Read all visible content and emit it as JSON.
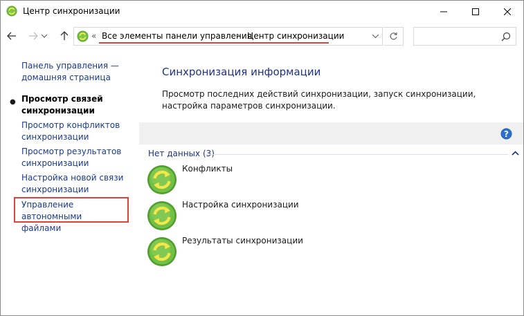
{
  "window": {
    "title": "Центр синхронизации",
    "icon": "sync-center-icon",
    "controls": [
      "minimize-icon",
      "maximize-icon",
      "close-icon"
    ]
  },
  "navigation": {
    "back_icon": "arrow-left-icon",
    "forward_icon": "arrow-right-icon",
    "recent_icon": "chevron-down-icon",
    "up_icon": "arrow-up-icon",
    "address": {
      "overflow_chevron": "«",
      "crumbs": [
        "Все элементы панели управления",
        "Центр синхронизации"
      ],
      "separator": "›",
      "highlight_color": "#e0413a"
    },
    "refresh_icon": "refresh-icon",
    "search": {
      "placeholder": "",
      "value": "",
      "icon": "search-icon"
    }
  },
  "sidebar": {
    "items": [
      {
        "label": "Панель управления —\nдомашняя страница",
        "current": false
      },
      {
        "label": "Просмотр связей\nсинхронизации",
        "current": true
      },
      {
        "label": "Просмотр конфликтов\nсинхронизации",
        "current": false
      },
      {
        "label": "Просмотр результатов\nсинхронизации",
        "current": false
      },
      {
        "label": "Настройка новой связи\nсинхронизации",
        "current": false
      },
      {
        "label": "Управление автономными\nфайлами",
        "current": false,
        "highlighted": true
      }
    ]
  },
  "main": {
    "heading": "Синхронизация информации",
    "description": "Просмотр последних действий синхронизации, запуск синхронизации, настройка параметров синхронизации.",
    "help_icon": "help-icon",
    "group": {
      "label": "Нет данных (3)",
      "collapse_icon": "chevron-up-icon",
      "items": [
        {
          "label": "Конфликты",
          "icon": "sync-icon"
        },
        {
          "label": "Настройка синхронизации",
          "icon": "sync-icon"
        },
        {
          "label": "Результаты синхронизации",
          "icon": "sync-icon"
        }
      ]
    }
  },
  "colors": {
    "link": "#1a3a8e",
    "heading": "#1e3287",
    "highlight": "#e0413a",
    "sync_green": "#6cbd45",
    "sync_yellow": "#f5e649",
    "help_blue": "#1a5fb4"
  }
}
